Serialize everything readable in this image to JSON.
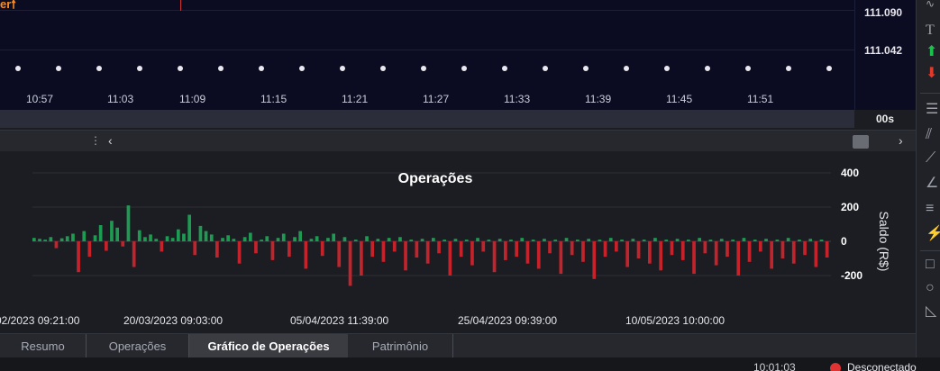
{
  "top_chart": {
    "order_label": "er",
    "time_labels": [
      "10:57",
      "11:03",
      "11:09",
      "11:15",
      "11:21",
      "11:27",
      "11:33",
      "11:39",
      "11:45",
      "11:51"
    ],
    "price_labels": [
      "111.090",
      "111.042"
    ],
    "timer": "00s"
  },
  "tabs": [
    {
      "label": "Resumo",
      "active": false
    },
    {
      "label": "Operações",
      "active": false
    },
    {
      "label": "Gráfico de Operações",
      "active": true
    },
    {
      "label": "Patrimônio",
      "active": false
    }
  ],
  "status": {
    "time": "10:01:03",
    "text": "Desconectado"
  },
  "toolbar": {
    "icons": [
      "text-tool-icon",
      "buy-arrow-icon",
      "sell-arrow-icon",
      "horizontal-lines-icon",
      "channel-icon",
      "fibonacci-fan-icon",
      "angle-icon",
      "levels-icon",
      "fibonacci-icon",
      "rectangle-icon",
      "circle-icon",
      "triangle-icon"
    ]
  },
  "colors": {
    "positive": "#1e9a52",
    "negative": "#c4232b",
    "chart_bg": "#0b0c22",
    "panel_bg": "#1b1d22",
    "order_label": "#ff8a1c"
  },
  "chart_data": {
    "type": "bar",
    "title": "Operações",
    "ylabel": "Saldo (R$)",
    "xlabel": "",
    "ylim": [
      -300,
      450
    ],
    "yticks": [
      400,
      200,
      0,
      -200
    ],
    "x_tick_labels": [
      "02/2023 09:21:00",
      "20/03/2023 09:03:00",
      "05/04/2023 11:39:00",
      "25/04/2023 09:39:00",
      "10/05/2023 10:00:00"
    ],
    "series": [
      {
        "values": [
          20,
          15,
          10,
          25,
          -40,
          18,
          30,
          45,
          -180,
          60,
          -90,
          35,
          95,
          -55,
          120,
          80,
          -30,
          210,
          -150,
          65,
          25,
          40,
          15,
          -60,
          30,
          20,
          70,
          45,
          155,
          -80,
          90,
          60,
          40,
          -95,
          20,
          35,
          15,
          -130,
          25,
          50,
          -70,
          10,
          30,
          -110,
          20,
          45,
          -90,
          25,
          60,
          -160,
          15,
          30,
          -85,
          20,
          45,
          -150,
          25,
          -260,
          10,
          -200,
          30,
          -90,
          15,
          -120,
          20,
          -60,
          25,
          -170,
          10,
          -95,
          15,
          -130,
          20,
          -70,
          10,
          -200,
          15,
          -90,
          10,
          -140,
          20,
          -60,
          10,
          -180,
          15,
          -110,
          10,
          -90,
          20,
          -130,
          10,
          -160,
          15,
          -70,
          10,
          -190,
          20,
          -80,
          10,
          -120,
          15,
          -220,
          10,
          -90,
          20,
          -60,
          10,
          -150,
          15,
          -100,
          10,
          -130,
          20,
          -170,
          10,
          -80,
          15,
          -110,
          10,
          -190,
          20,
          -70,
          10,
          -140,
          15,
          -90,
          10,
          -200,
          20,
          -120,
          10,
          -60,
          15,
          -160,
          10,
          -100,
          20,
          -130,
          10,
          -80,
          15,
          -150,
          10,
          -95
        ]
      }
    ]
  }
}
